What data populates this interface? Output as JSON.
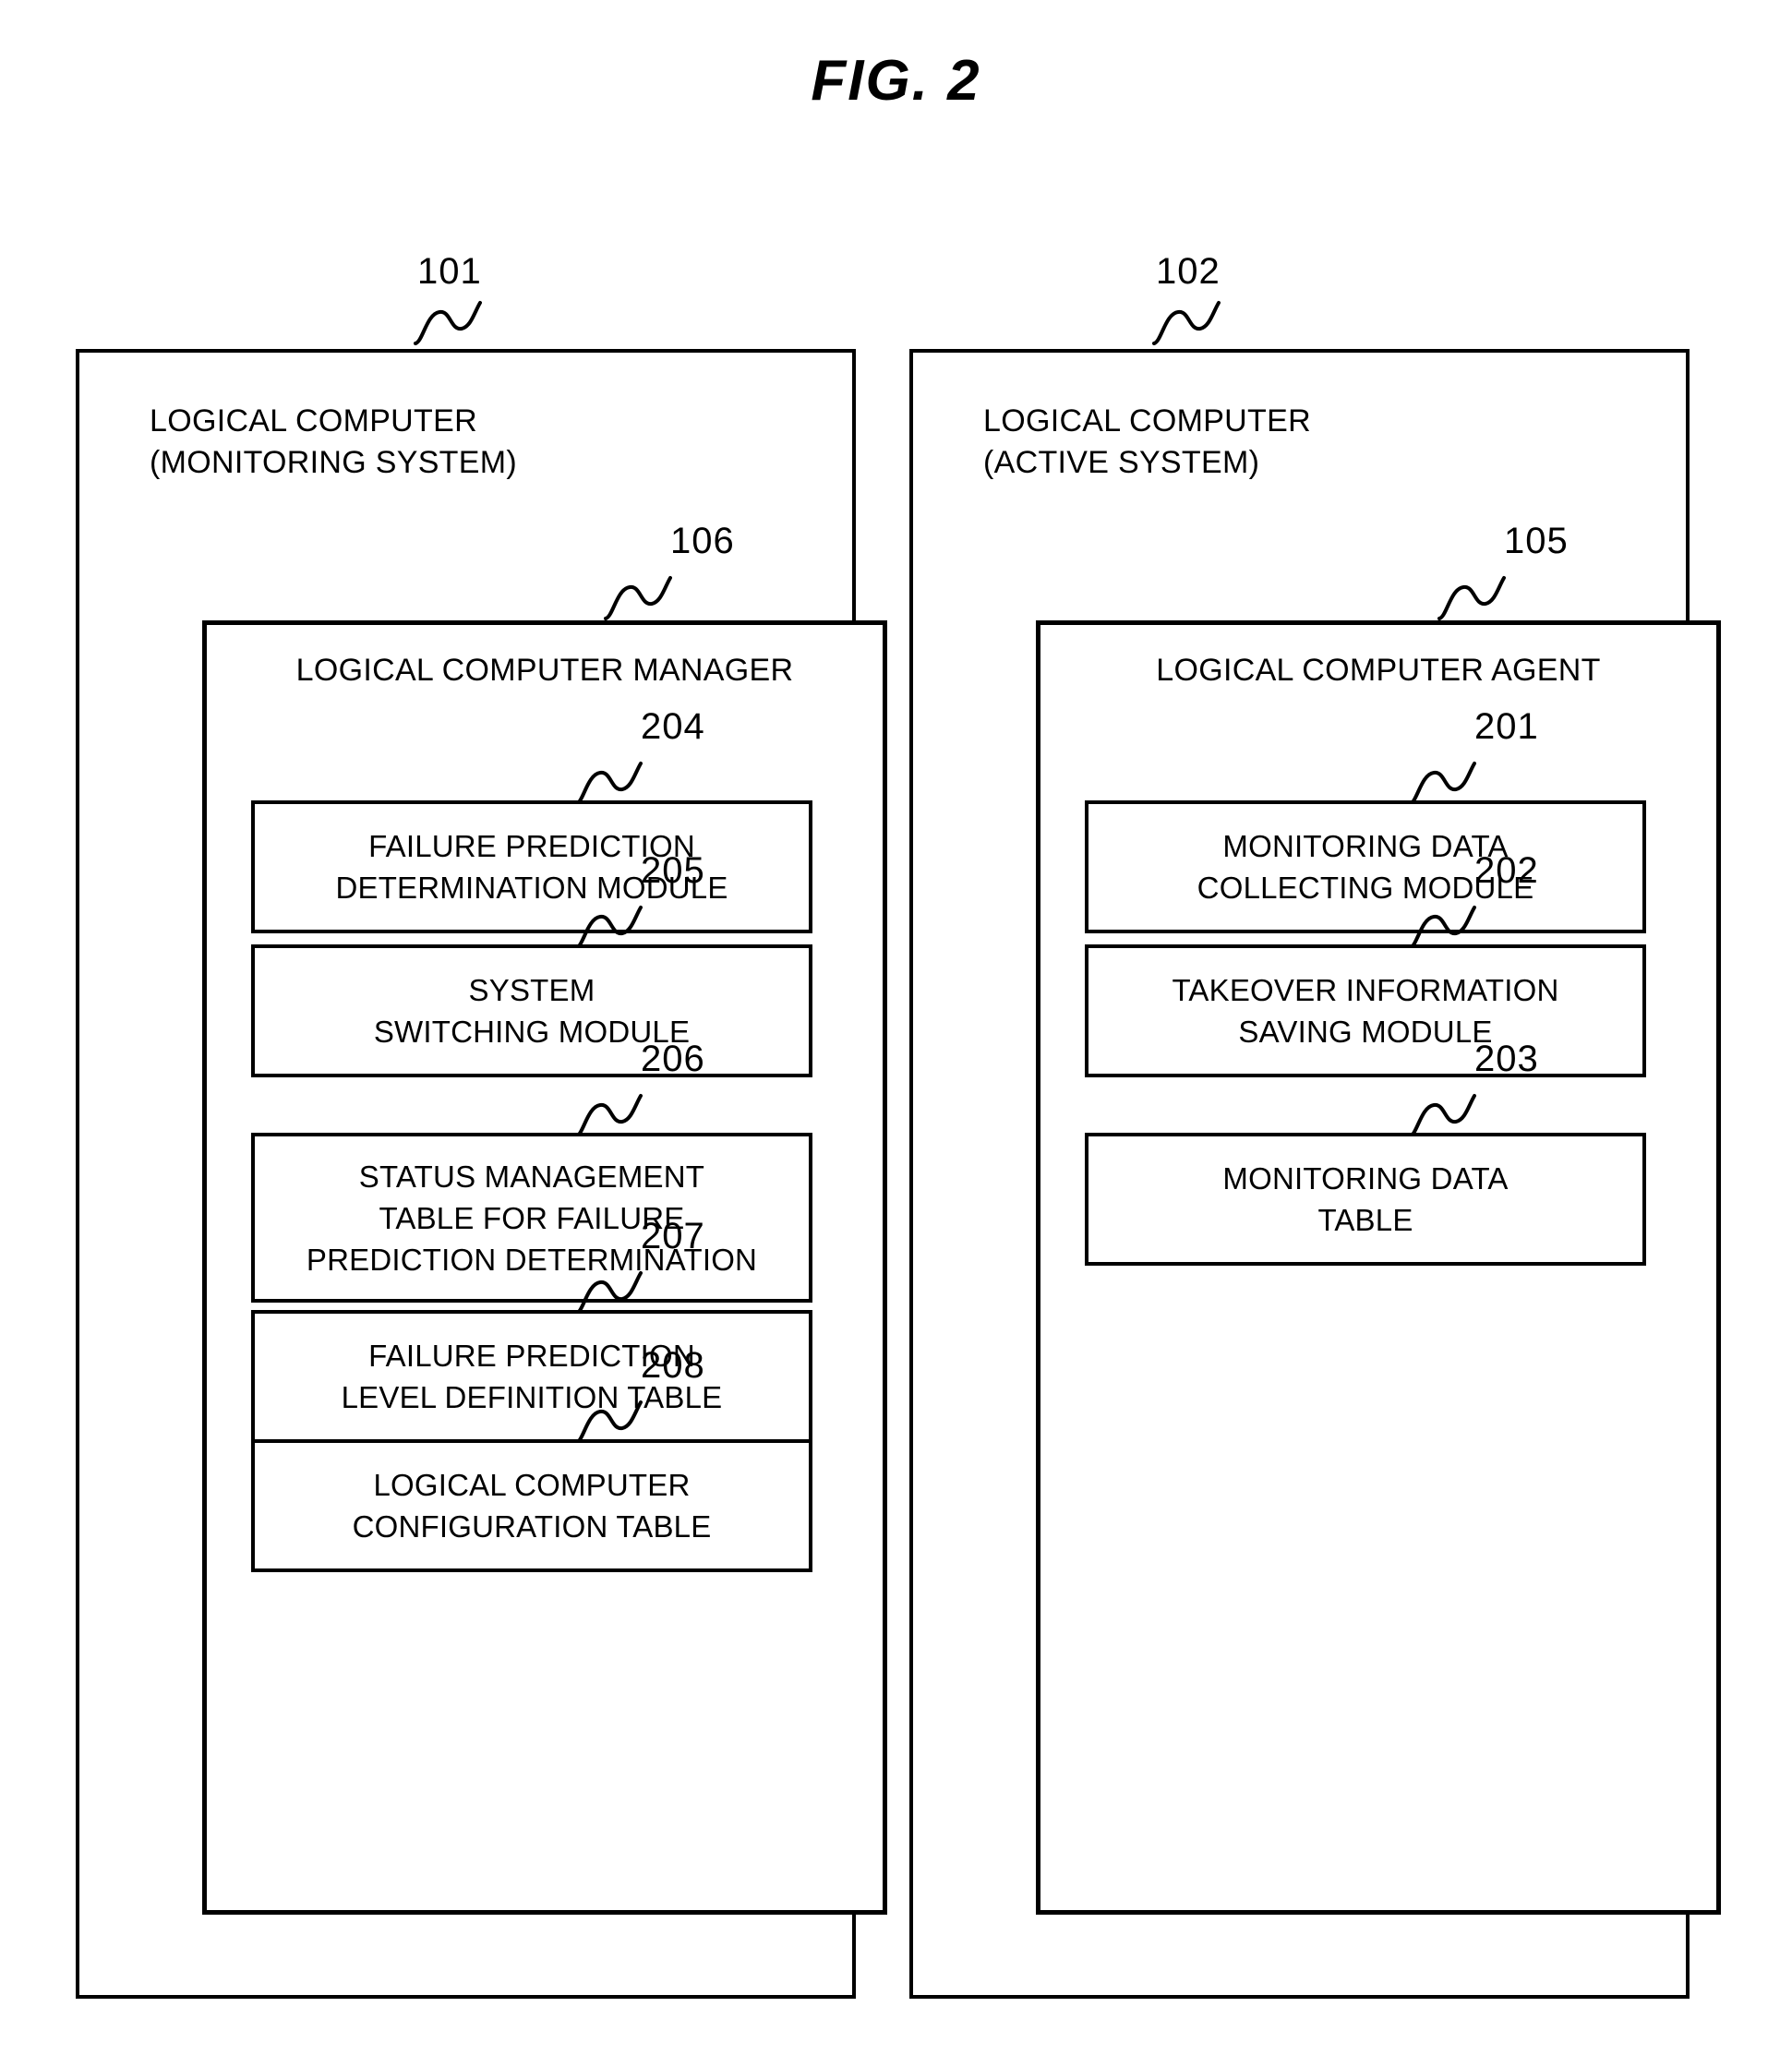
{
  "figure": {
    "title": "FIG. 2"
  },
  "systems": [
    {
      "ref": "101",
      "title": "LOGICAL COMPUTER\n(MONITORING SYSTEM)",
      "inner": {
        "ref": "106",
        "title": "LOGICAL COMPUTER MANAGER",
        "modules": [
          {
            "ref": "204",
            "label": "FAILURE PREDICTION\nDETERMINATION MODULE"
          },
          {
            "ref": "205",
            "label": "SYSTEM\nSWITCHING MODULE"
          },
          {
            "ref": "206",
            "label": "STATUS MANAGEMENT\nTABLE FOR FAILURE\nPREDICTION DETERMINATION"
          },
          {
            "ref": "207",
            "label": "FAILURE PREDICTION\nLEVEL DEFINITION TABLE"
          },
          {
            "ref": "208",
            "label": "LOGICAL COMPUTER\nCONFIGURATION TABLE"
          }
        ]
      }
    },
    {
      "ref": "102",
      "title": "LOGICAL COMPUTER\n(ACTIVE SYSTEM)",
      "inner": {
        "ref": "105",
        "title": "LOGICAL COMPUTER AGENT",
        "modules": [
          {
            "ref": "201",
            "label": "MONITORING DATA\nCOLLECTING MODULE"
          },
          {
            "ref": "202",
            "label": "TAKEOVER INFORMATION\nSAVING MODULE"
          },
          {
            "ref": "203",
            "label": "MONITORING DATA\nTABLE"
          }
        ]
      }
    }
  ],
  "colors": {
    "stroke": "#000000",
    "background": "#ffffff"
  }
}
